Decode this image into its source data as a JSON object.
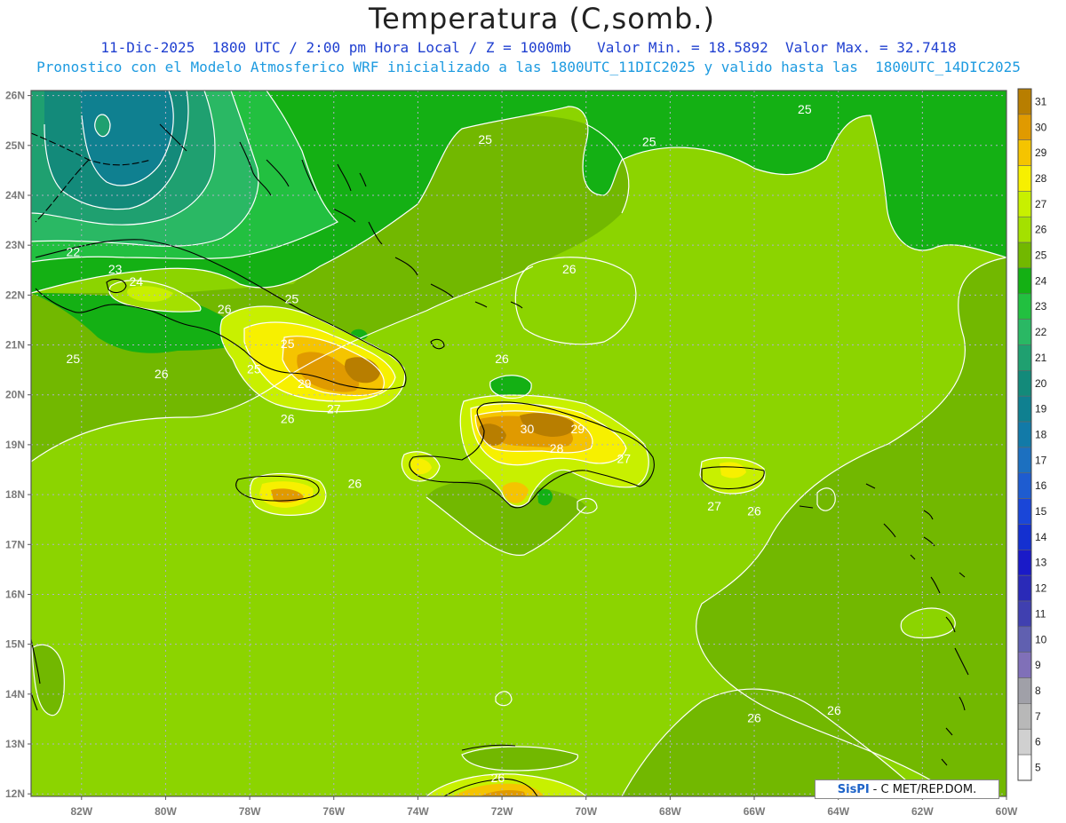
{
  "header": {
    "title": "Temperatura (C,somb.)",
    "subtitle_line1": "11-Dic-2025  1800 UTC / 2:00 pm Hora Local / Z = 1000mb   Valor Min. = 18.5892  Valor Max. = 32.7418",
    "subtitle_line2": "Pronostico con el Modelo Atmosferico WRF inicializado a las 1800UTC_11DIC2025 y valido hasta las  1800UTC_14DIC2025"
  },
  "axes": {
    "lat_labels": [
      "26N",
      "25N",
      "24N",
      "23N",
      "22N",
      "21N",
      "20N",
      "19N",
      "18N",
      "17N",
      "16N",
      "15N",
      "14N",
      "13N",
      "12N"
    ],
    "lon_labels": [
      "82W",
      "80W",
      "78W",
      "76W",
      "74W",
      "72W",
      "70W",
      "68W",
      "66W",
      "64W",
      "62W",
      "60W"
    ]
  },
  "colorbar": {
    "labels": [
      "31",
      "30",
      "29",
      "28",
      "27",
      "26",
      "25",
      "24",
      "23",
      "22",
      "21",
      "20",
      "19",
      "18",
      "17",
      "16",
      "15",
      "14",
      "13",
      "12",
      "11",
      "10",
      "9",
      "8",
      "7",
      "6",
      "5"
    ],
    "colors": [
      "#b87e00",
      "#e09a00",
      "#f5c400",
      "#f7f000",
      "#c8f000",
      "#a4e000",
      "#72b800",
      "#14b014",
      "#22c040",
      "#2ab864",
      "#1fa070",
      "#138a7a",
      "#0f8090",
      "#127aa8",
      "#1c70c0",
      "#1e5cd0",
      "#1a46d8",
      "#1430d0",
      "#1a1ac8",
      "#2a2ab8",
      "#4040b0",
      "#6060b0",
      "#8070b8",
      "#a0a0a8",
      "#b8b8b8",
      "#d0d0d0",
      "#ffffff"
    ]
  },
  "contour_labels": [
    {
      "text": "22",
      "lon": -82.2,
      "lat": 22.85
    },
    {
      "text": "23",
      "lon": -81.2,
      "lat": 22.5
    },
    {
      "text": "24",
      "lon": -80.7,
      "lat": 22.25
    },
    {
      "text": "25",
      "lon": -82.2,
      "lat": 20.7
    },
    {
      "text": "26",
      "lon": -80.1,
      "lat": 20.4
    },
    {
      "text": "26",
      "lon": -78.6,
      "lat": 21.7
    },
    {
      "text": "25",
      "lon": -77.0,
      "lat": 21.9
    },
    {
      "text": "25",
      "lon": -77.1,
      "lat": 21.0
    },
    {
      "text": "25",
      "lon": -77.9,
      "lat": 20.5
    },
    {
      "text": "29",
      "lon": -76.7,
      "lat": 20.2
    },
    {
      "text": "27",
      "lon": -76.0,
      "lat": 19.7
    },
    {
      "text": "26",
      "lon": -77.1,
      "lat": 19.5
    },
    {
      "text": "26",
      "lon": -75.5,
      "lat": 18.2
    },
    {
      "text": "25",
      "lon": -72.4,
      "lat": 25.1
    },
    {
      "text": "25",
      "lon": -68.5,
      "lat": 25.05
    },
    {
      "text": "25",
      "lon": -64.8,
      "lat": 25.7
    },
    {
      "text": "26",
      "lon": -70.4,
      "lat": 22.5
    },
    {
      "text": "26",
      "lon": -72.0,
      "lat": 20.7
    },
    {
      "text": "30",
      "lon": -71.4,
      "lat": 19.3
    },
    {
      "text": "29",
      "lon": -70.2,
      "lat": 19.3
    },
    {
      "text": "28",
      "lon": -70.7,
      "lat": 18.9
    },
    {
      "text": "27",
      "lon": -69.1,
      "lat": 18.7
    },
    {
      "text": "27",
      "lon": -66.95,
      "lat": 17.75
    },
    {
      "text": "26",
      "lon": -66.0,
      "lat": 17.65
    },
    {
      "text": "26",
      "lon": -66.0,
      "lat": 13.5
    },
    {
      "text": "26",
      "lon": -64.1,
      "lat": 13.65
    },
    {
      "text": "26",
      "lon": -72.1,
      "lat": 12.3
    }
  ],
  "footer": {
    "brand": "SisPI",
    "rest": "- C   MET/REP.DOM."
  }
}
